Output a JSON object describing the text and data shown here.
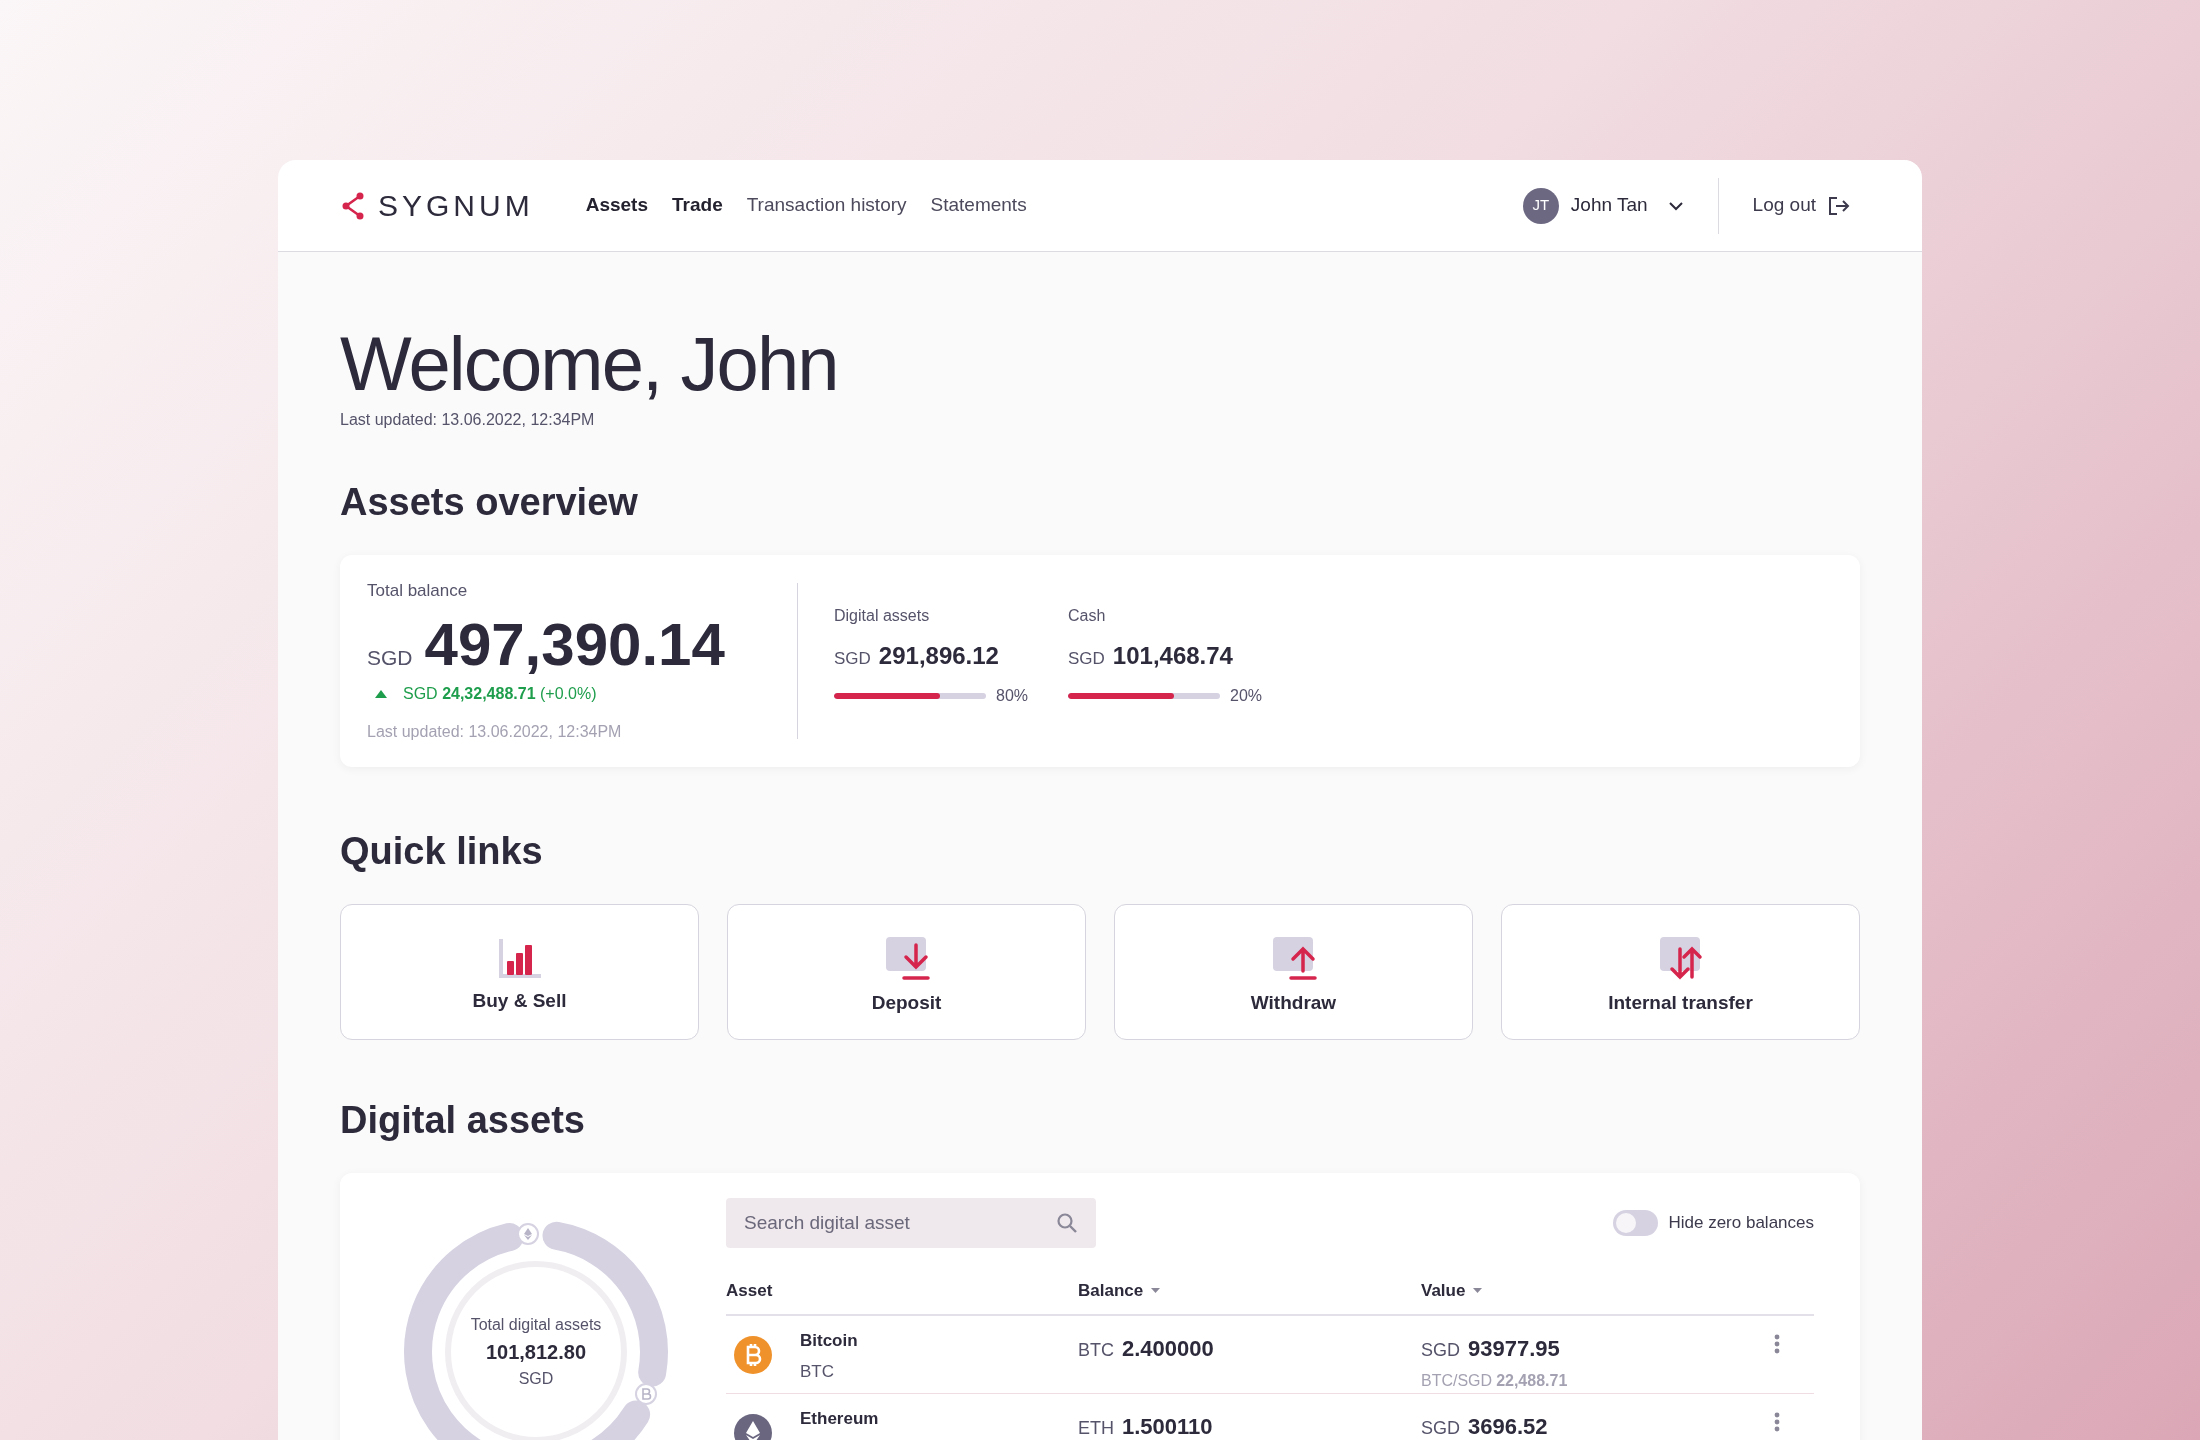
{
  "header": {
    "logo": "SYGNUM",
    "nav": [
      {
        "label": "Assets",
        "selected": true
      },
      {
        "label": "Trade",
        "selected": true
      },
      {
        "label": "Transaction history",
        "selected": false
      },
      {
        "label": "Statements",
        "selected": false
      }
    ],
    "user": {
      "initials": "JT",
      "name": "John Tan"
    },
    "logout": "Log out"
  },
  "welcome": {
    "title": "Welcome, John",
    "updated": "Last updated: 13.06.2022, 12:34PM"
  },
  "overview": {
    "title": "Assets overview",
    "total_label": "Total balance",
    "currency": "SGD",
    "total": "497,390.14",
    "change_currency": "SGD",
    "change": "24,32,488.71",
    "change_pct": "(+0.0%)",
    "updated": "Last updated: 13.06.2022, 12:34PM",
    "parts": [
      {
        "label": "Digital assets",
        "currency": "SGD",
        "amount": "291,896.12",
        "level": 0.7,
        "pct": "80%"
      },
      {
        "label": "Cash",
        "currency": "SGD",
        "amount": "101,468.74",
        "level": 0.7,
        "pct": "20%"
      }
    ]
  },
  "quick_links": {
    "title": "Quick links",
    "items": [
      {
        "label": "Buy & Sell"
      },
      {
        "label": "Deposit"
      },
      {
        "label": "Withdraw"
      },
      {
        "label": "Internal transfer"
      }
    ]
  },
  "digital_assets": {
    "title": "Digital assets",
    "donut": {
      "label": "Total digital assets",
      "value": "101,812.80",
      "currency": "SGD"
    },
    "search": {
      "placeholder": "Search digital asset"
    },
    "hide_zero": {
      "label": "Hide zero balances",
      "on": false
    },
    "columns": [
      "Asset",
      "Balance",
      "Value"
    ],
    "rows": [
      {
        "name": "Bitcoin",
        "ticker": "BTC",
        "balance_unit": "BTC",
        "balance": "2.400000",
        "value_unit": "SGD",
        "value": "93977.95",
        "rate_unit": "BTC/SGD",
        "rate": "22,488.71"
      },
      {
        "name": "Ethereum",
        "balance_unit": "ETH",
        "balance": "1.500110",
        "value_unit": "SGD",
        "value": "3696.52"
      }
    ]
  }
}
